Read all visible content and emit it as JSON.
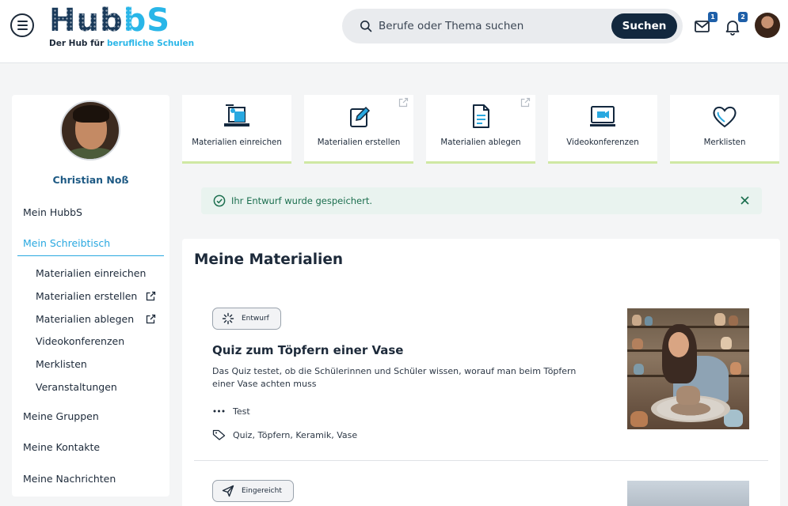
{
  "header": {
    "logo_dark": "Hub",
    "logo_light": "bS",
    "tagline_prefix": "Der Hub für ",
    "tagline_highlight": "berufliche Schulen",
    "search_placeholder": "Berufe oder Thema suchen",
    "search_button": "Suchen",
    "mail_count": "1",
    "notification_count": "2"
  },
  "sidebar": {
    "user_name": "Christian Noß",
    "items": [
      {
        "label": "Mein HubbS",
        "active": false
      },
      {
        "label": "Mein Schreibtisch",
        "active": true
      }
    ],
    "sub_items": [
      {
        "label": "Materialien einreichen",
        "external": false
      },
      {
        "label": "Materialien erstellen",
        "external": true
      },
      {
        "label": "Materialien ablegen",
        "external": true
      },
      {
        "label": "Videokonferenzen",
        "external": false
      },
      {
        "label": "Merklisten",
        "external": false
      },
      {
        "label": "Veranstaltungen",
        "external": false
      }
    ],
    "bottom_items": [
      {
        "label": "Meine Gruppen"
      },
      {
        "label": "Meine Kontakte"
      },
      {
        "label": "Meine Nachrichten"
      }
    ]
  },
  "tiles": [
    {
      "label": "Materialien einreichen",
      "icon": "presenter-icon",
      "external": false
    },
    {
      "label": "Materialien erstellen",
      "icon": "edit-icon",
      "external": true
    },
    {
      "label": "Materialien ablegen",
      "icon": "document-icon",
      "external": true
    },
    {
      "label": "Videokonferenzen",
      "icon": "video-icon",
      "external": false
    },
    {
      "label": "Merklisten",
      "icon": "heart-icon",
      "external": false
    }
  ],
  "alert": {
    "message": "Ihr Entwurf wurde gespeichert."
  },
  "materials": {
    "title": "Meine Materialien",
    "items": [
      {
        "status": "Entwurf",
        "title": "Quiz zum Töpfern einer Vase",
        "description": "Das Quiz testet, ob die Schülerinnen und Schüler wissen, worauf man beim Töpfern einer Vase achten muss",
        "type": "Test",
        "tags": "Quiz, Töpfern, Keramik, Vase"
      },
      {
        "status": "Eingereicht"
      }
    ]
  },
  "colors": {
    "accent": "#29a8e0",
    "dark_navy": "#13283e",
    "tile_underline": "#cfe8a3",
    "success_text": "#1c6f4f",
    "success_bg": "#e9f3ef"
  }
}
